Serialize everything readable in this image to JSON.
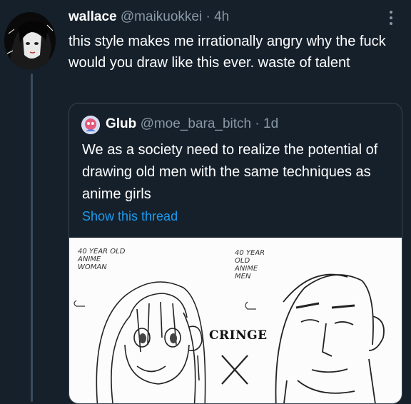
{
  "tweet": {
    "name": "wallace",
    "handle": "@maikuokkei",
    "separator": "·",
    "time": "4h",
    "text": "this style makes me irrationally angry why the fuck would you draw like this ever. waste of talent",
    "more_icon": "more-vertical-icon"
  },
  "quote": {
    "name": "Glub",
    "handle": "@moe_bara_bitch",
    "separator": "·",
    "time": "1d",
    "text": "We as a society need to realize the potential of drawing old men with the same techniques as anime girls",
    "show_thread": "Show this thread",
    "image": {
      "label_left": "40 YEAR OLD ANIME WOMAN",
      "label_right": "40 YEAR OLD ANIME MEN",
      "center_label": "CRINGE"
    }
  },
  "colors": {
    "background": "#15202b",
    "link": "#1d9bf0",
    "muted": "#8b98a5",
    "border": "#38444d"
  }
}
